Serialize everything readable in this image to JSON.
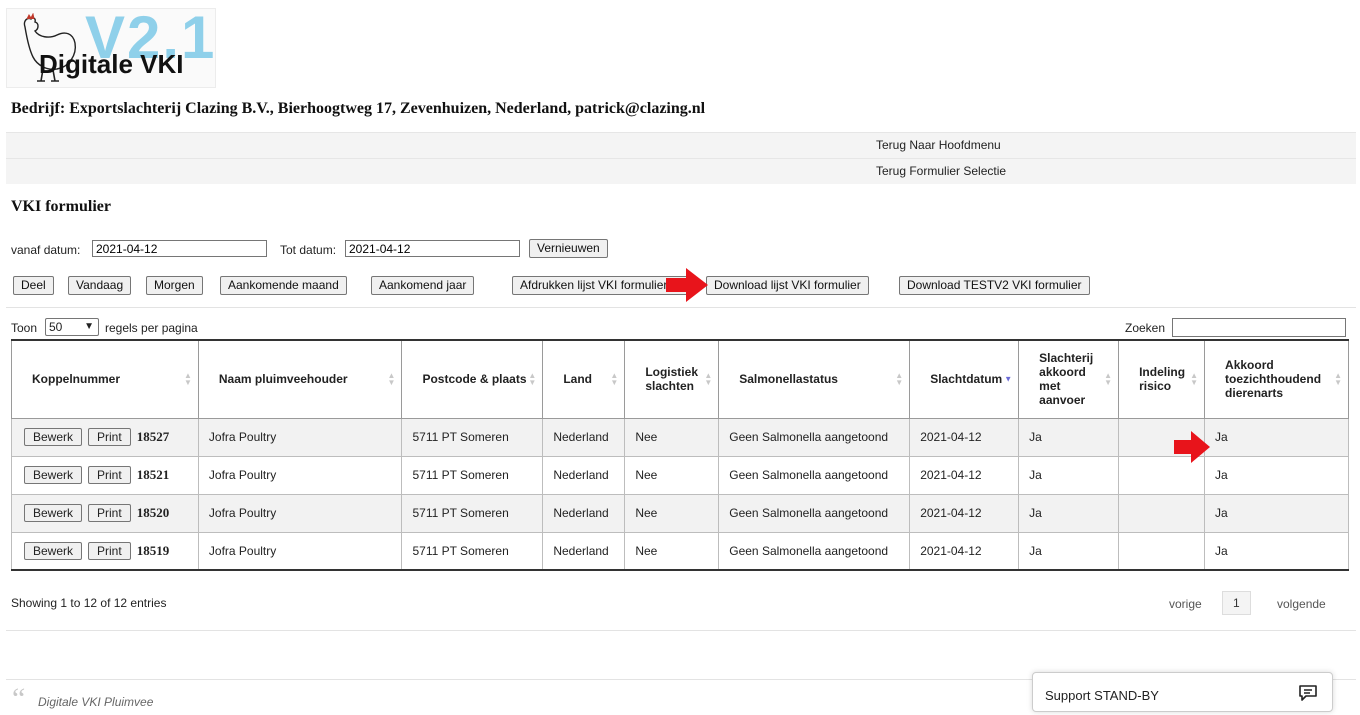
{
  "logo": {
    "version": "V2.1",
    "name": "Digitale VKI"
  },
  "company": "Bedrijf: Exportslachterij Clazing B.V., Bierhoogtweg 17, Zevenhuizen, Nederland, patrick@clazing.nl",
  "menu": {
    "back_main": "Terug Naar Hoofdmenu",
    "back_forms": "Terug Formulier Selectie"
  },
  "section_title": "VKI formulier",
  "filters": {
    "from_label": "vanaf datum:",
    "from_value": "2021-04-12",
    "to_label": "Tot datum:",
    "to_value": "2021-04-12",
    "refresh": "Vernieuwen"
  },
  "buttons": {
    "deel": "Deel",
    "vandaag": "Vandaag",
    "morgen": "Morgen",
    "aankomende_maand": "Aankomende maand",
    "aankomend_jaar": "Aankomend jaar",
    "afdrukken": "Afdrukken lijst VKI formulier",
    "download": "Download lijst VKI formulier",
    "download_testv2": "Download TESTV2 VKI formulier"
  },
  "table_controls": {
    "show_label": "Toon",
    "page_size": "50",
    "per_page_label": "regels per pagina",
    "search_label": "Zoeken"
  },
  "columns": [
    "Koppelnummer",
    "Naam pluimveehouder",
    "Postcode & plaats",
    "Land",
    "Logistiek slachten",
    "Salmonellastatus",
    "Slachtdatum",
    "Slachterij akkoord met aanvoer",
    "Indeling risico",
    "Akkoord toezichthoudend dierenarts"
  ],
  "row_actions": {
    "edit": "Bewerk",
    "print": "Print"
  },
  "rows": [
    {
      "nr": "18527",
      "naam": "Jofra Poultry",
      "plaats": "5711 PT Someren",
      "land": "Nederland",
      "logistiek": "Nee",
      "salmonella": "Geen Salmonella aangetoond",
      "datum": "2021-04-12",
      "slachterij": "Ja",
      "risico": "",
      "akkoord": "Ja"
    },
    {
      "nr": "18521",
      "naam": "Jofra Poultry",
      "plaats": "5711 PT Someren",
      "land": "Nederland",
      "logistiek": "Nee",
      "salmonella": "Geen Salmonella aangetoond",
      "datum": "2021-04-12",
      "slachterij": "Ja",
      "risico": "",
      "akkoord": "Ja"
    },
    {
      "nr": "18520",
      "naam": "Jofra Poultry",
      "plaats": "5711 PT Someren",
      "land": "Nederland",
      "logistiek": "Nee",
      "salmonella": "Geen Salmonella aangetoond",
      "datum": "2021-04-12",
      "slachterij": "Ja",
      "risico": "",
      "akkoord": "Ja"
    },
    {
      "nr": "18519",
      "naam": "Jofra Poultry",
      "plaats": "5711 PT Someren",
      "land": "Nederland",
      "logistiek": "Nee",
      "salmonella": "Geen Salmonella aangetoond",
      "datum": "2021-04-12",
      "slachterij": "Ja",
      "risico": "",
      "akkoord": "Ja"
    }
  ],
  "footer": {
    "showing": "Showing 1 to 12 of 12 entries",
    "prev": "vorige",
    "page": "1",
    "next": "volgende"
  },
  "quote": "Digitale VKI Pluimvee",
  "support": "Support STAND-BY",
  "colors": {
    "accent_red": "#e8141b",
    "logo_blue": "#8fd0ea"
  }
}
